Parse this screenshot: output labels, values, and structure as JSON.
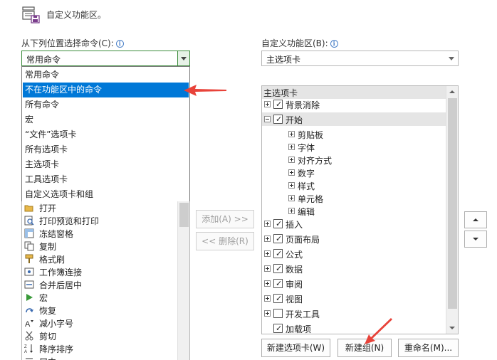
{
  "header": {
    "title": "自定义功能区。"
  },
  "left": {
    "choose_label": "从下列位置选择命令(C):",
    "combo_value": "常用命令",
    "dropdown_items": [
      "常用命令",
      "不在功能区中的命令",
      "所有命令",
      "宏",
      "“文件”选项卡",
      "所有选项卡",
      "主选项卡",
      "工具选项卡",
      "自定义选项卡和组"
    ],
    "selected_index": 1,
    "commands": [
      {
        "label": "打开",
        "icon": "open-folder-icon"
      },
      {
        "label": "打印预览和打印",
        "icon": "print-preview-icon"
      },
      {
        "label": "冻结窗格",
        "icon": "freeze-panes-icon",
        "submenu": true
      },
      {
        "label": "复制",
        "icon": "copy-icon"
      },
      {
        "label": "格式刷",
        "icon": "format-painter-icon"
      },
      {
        "label": "工作簿连接",
        "icon": "workbook-connections-icon"
      },
      {
        "label": "合并后居中",
        "icon": "merge-center-icon"
      },
      {
        "label": "宏",
        "icon": "macro-play-icon"
      },
      {
        "label": "恢复",
        "icon": "redo-icon",
        "submenu_bar": true
      },
      {
        "label": "减小字号",
        "icon": "decrease-font-icon"
      },
      {
        "label": "剪切",
        "icon": "cut-icon"
      },
      {
        "label": "降序排序",
        "icon": "sort-descending-icon"
      },
      {
        "label": "居中",
        "icon": "center-align-icon"
      }
    ]
  },
  "middle": {
    "add_label": "添加(A) >>",
    "remove_label": "<< 删除(R)"
  },
  "right": {
    "customize_label": "自定义功能区(B):",
    "combo_value": "主选项卡",
    "tree_header": "主选项卡",
    "tree": [
      {
        "label": "背景消除",
        "level": 1,
        "expander": "plus",
        "checked": true
      },
      {
        "label": "开始",
        "level": 1,
        "expander": "minus",
        "checked": true,
        "highlighted": true
      },
      {
        "label": "剪贴板",
        "level": 2,
        "expander": "plus"
      },
      {
        "label": "字体",
        "level": 2,
        "expander": "plus"
      },
      {
        "label": "对齐方式",
        "level": 2,
        "expander": "plus"
      },
      {
        "label": "数字",
        "level": 2,
        "expander": "plus"
      },
      {
        "label": "样式",
        "level": 2,
        "expander": "plus"
      },
      {
        "label": "单元格",
        "level": 2,
        "expander": "plus"
      },
      {
        "label": "编辑",
        "level": 2,
        "expander": "plus"
      },
      {
        "label": "插入",
        "level": 1,
        "expander": "plus",
        "checked": true
      },
      {
        "label": "页面布局",
        "level": 1,
        "expander": "plus",
        "checked": true
      },
      {
        "label": "公式",
        "level": 1,
        "expander": "plus",
        "checked": true
      },
      {
        "label": "数据",
        "level": 1,
        "expander": "plus",
        "checked": true
      },
      {
        "label": "审阅",
        "level": 1,
        "expander": "plus",
        "checked": true
      },
      {
        "label": "视图",
        "level": 1,
        "expander": "plus",
        "checked": true
      },
      {
        "label": "开发工具",
        "level": 1,
        "expander": "plus",
        "checked": false
      },
      {
        "label": "加载项",
        "level": 1,
        "expander": "none",
        "checked": true
      }
    ],
    "new_tab_label": "新建选项卡(W)",
    "new_group_label": "新建组(N)",
    "rename_label": "重命名(M)..."
  },
  "colors": {
    "selection": "#0078d7",
    "arrow": "#e8433a",
    "highlight_row": "#e5e5e5"
  }
}
